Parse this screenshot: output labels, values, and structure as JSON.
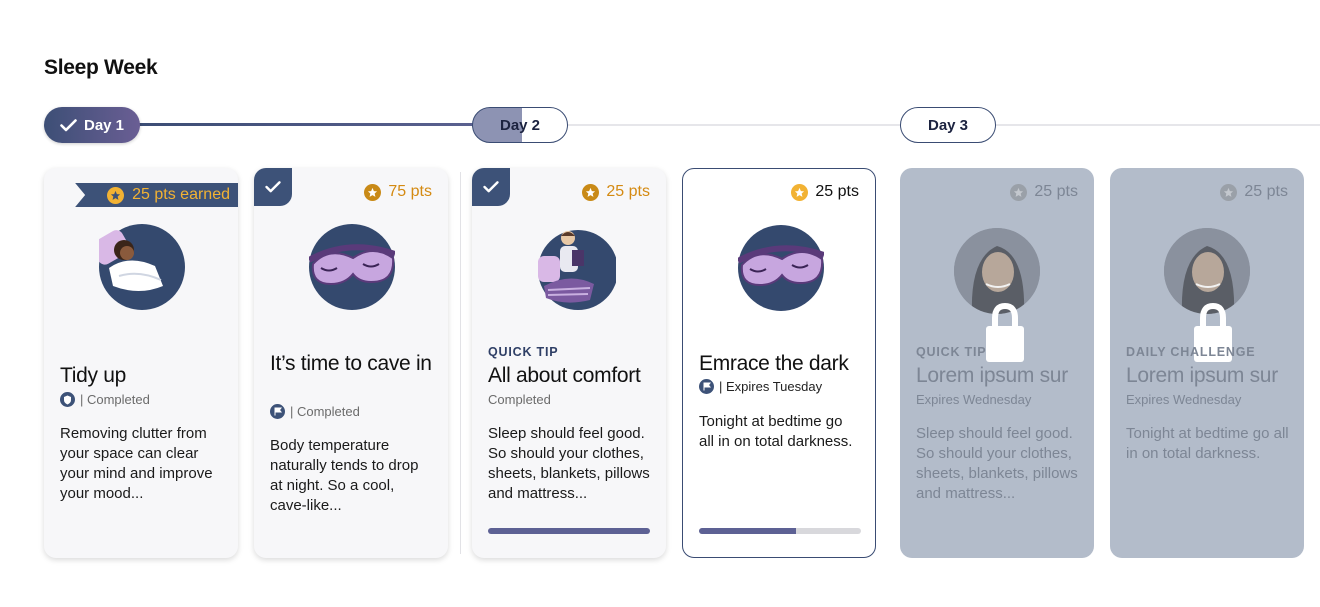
{
  "page": {
    "title": "Sleep Week"
  },
  "timeline": {
    "days": [
      {
        "label": "Day 1",
        "state": "completed"
      },
      {
        "label": "Day 2",
        "state": "in-progress",
        "progress": 0.52
      },
      {
        "label": "Day 3",
        "state": "upcoming"
      }
    ]
  },
  "cards": [
    {
      "badge": "25 pts earned",
      "title": "Tidy up",
      "status": "| Completed",
      "icon": "shield-icon",
      "illustration": "person-sleeping-on-pillow",
      "description": "Removing clutter from your space can clear your mind and improve your mood..."
    },
    {
      "points": "75 pts",
      "checked": true,
      "title": "It’s time to cave in",
      "status": "| Completed",
      "icon": "flag-icon",
      "illustration": "sleep-mask",
      "description": "Body temperature naturally tends to drop at night. So a cool, cave-like..."
    },
    {
      "points": "25 pts",
      "checked": true,
      "eyebrow": "QUICK TIP",
      "title": "All about comfort",
      "status": "Completed",
      "illustration": "person-reading-in-bed",
      "description": "Sleep should feel good. So should your clothes, sheets, blankets, pillows and mattress...",
      "progress": 1.0
    },
    {
      "points": "25 pts",
      "title": "Emrace the dark",
      "status": "| Expires Tuesday",
      "icon": "flag-icon",
      "illustration": "sleep-mask",
      "description": "Tonight at bedtime go all in on total darkness.",
      "progress": 0.6
    },
    {
      "points": "25 pts",
      "locked": true,
      "eyebrow": "QUICK TIP",
      "title": "Lorem ipsum sur",
      "status": "Expires Wednesday",
      "illustration": "woman-portrait",
      "description": "Sleep should feel good. So should your clothes, sheets, blankets, pillows and mattress..."
    },
    {
      "points": "25 pts",
      "locked": true,
      "eyebrow": "DAILY CHALLENGE",
      "title": "Lorem ipsum sur",
      "status": "Expires Wednesday",
      "illustration": "woman-portrait",
      "description": "Tonight at bedtime go all in on total darkness."
    }
  ],
  "colors": {
    "primary": "#3d5278",
    "accent": "#f2b233",
    "locked": "#b3bcca",
    "progress": "#5d6194"
  }
}
